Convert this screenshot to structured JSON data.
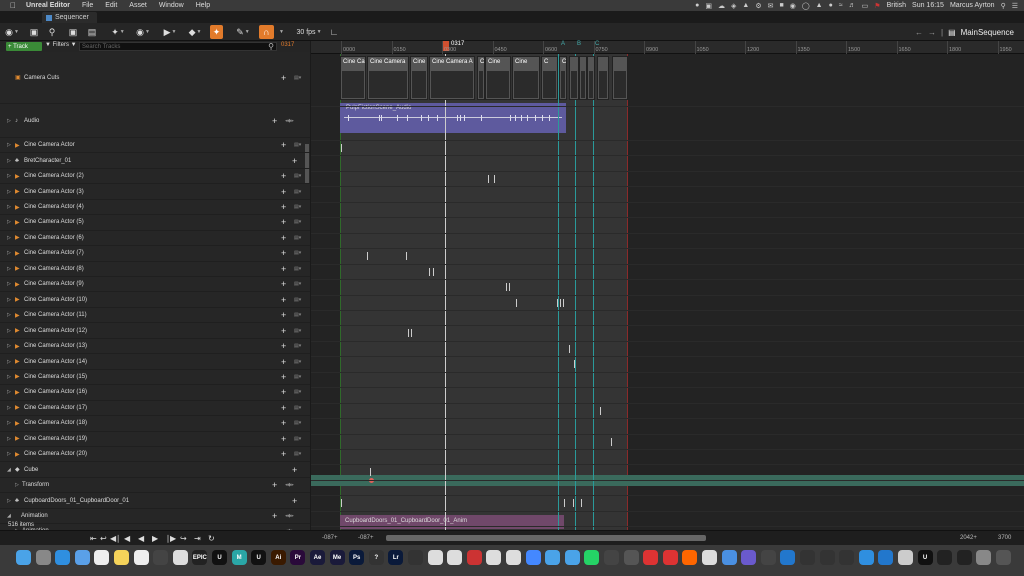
{
  "menubar": {
    "app": "Unreal Editor",
    "items": [
      "File",
      "Edit",
      "Asset",
      "Window",
      "Help"
    ],
    "language": "British",
    "clock": "Sun 16:15",
    "user": "Marcus Ayrton"
  },
  "tab": {
    "label": "Sequencer"
  },
  "toolbar": {
    "fps": "30 fps",
    "sequence": "MainSequence"
  },
  "tracks_header": {
    "track_label": "+ Track",
    "filters_label": "Filters",
    "search_placeholder": "Search Tracks",
    "current_frame": "0317"
  },
  "ruler": {
    "ticks": [
      "0000",
      "0150",
      "0300",
      "0450",
      "0600",
      "0750",
      "0900",
      "1050",
      "1200",
      "1350",
      "1500",
      "1650",
      "1800",
      "1950"
    ],
    "playhead": "0317",
    "markers": [
      "A",
      "B",
      "C"
    ]
  },
  "tracks": [
    {
      "label": "Camera Cuts",
      "kind": "cuts"
    },
    {
      "label": "Audio",
      "kind": "audio"
    },
    {
      "label": "Cine Camera Actor",
      "kind": "camera"
    },
    {
      "label": "BretCharacter_01",
      "kind": "character"
    },
    {
      "label": "Cine Camera Actor (2)",
      "kind": "camera"
    },
    {
      "label": "Cine Camera Actor (3)",
      "kind": "camera"
    },
    {
      "label": "Cine Camera Actor (4)",
      "kind": "camera"
    },
    {
      "label": "Cine Camera Actor (5)",
      "kind": "camera"
    },
    {
      "label": "Cine Camera Actor (6)",
      "kind": "camera"
    },
    {
      "label": "Cine Camera Actor (7)",
      "kind": "camera"
    },
    {
      "label": "Cine Camera Actor (8)",
      "kind": "camera"
    },
    {
      "label": "Cine Camera Actor (9)",
      "kind": "camera"
    },
    {
      "label": "Cine Camera Actor (10)",
      "kind": "camera"
    },
    {
      "label": "Cine Camera Actor (11)",
      "kind": "camera"
    },
    {
      "label": "Cine Camera Actor (12)",
      "kind": "camera"
    },
    {
      "label": "Cine Camera Actor (13)",
      "kind": "camera"
    },
    {
      "label": "Cine Camera Actor (14)",
      "kind": "camera"
    },
    {
      "label": "Cine Camera Actor (15)",
      "kind": "camera"
    },
    {
      "label": "Cine Camera Actor (16)",
      "kind": "camera"
    },
    {
      "label": "Cine Camera Actor (17)",
      "kind": "camera"
    },
    {
      "label": "Cine Camera Actor (18)",
      "kind": "camera"
    },
    {
      "label": "Cine Camera Actor (19)",
      "kind": "camera"
    },
    {
      "label": "Cine Camera Actor (20)",
      "kind": "camera"
    },
    {
      "label": "Cube",
      "kind": "cube"
    },
    {
      "label": "Transform",
      "kind": "transform"
    },
    {
      "label": "CupboardDoors_01_CupboardDoor_01",
      "kind": "character"
    },
    {
      "label": "Animation",
      "kind": "animation"
    },
    {
      "label": "Animation",
      "kind": "animation-sub"
    }
  ],
  "item_count": "516 items",
  "shots": [
    "Cine Ca",
    "Cine Camera",
    "Cine",
    "Cine Camera A",
    "C",
    "Cine",
    "Cine",
    "C",
    "Cine"
  ],
  "audio_clip": "PulpFictionScene_Audio",
  "anim_clip": "CupboardDoors_01_CupboardDoor_01_Anim",
  "bottom": {
    "range_start_a": "-087+",
    "range_start_b": "-087+",
    "range_end_a": "2042+",
    "range_end_b": "3700"
  },
  "dock": [
    {
      "name": "finder",
      "color": "#4aa3e8",
      "text": ""
    },
    {
      "name": "launchpad",
      "color": "#888",
      "text": ""
    },
    {
      "name": "safari",
      "color": "#2f8fe0",
      "text": ""
    },
    {
      "name": "mail",
      "color": "#5aa0e8",
      "text": ""
    },
    {
      "name": "calendar",
      "color": "#eeeeee",
      "text": ""
    },
    {
      "name": "notes",
      "color": "#f5d35a",
      "text": ""
    },
    {
      "name": "reminders",
      "color": "#eeeeee",
      "text": ""
    },
    {
      "name": "finalcut",
      "color": "#444",
      "text": ""
    },
    {
      "name": "photos",
      "color": "#dddddd",
      "text": ""
    },
    {
      "name": "epic",
      "color": "#222",
      "text": "EPIC"
    },
    {
      "name": "unreal",
      "color": "#111",
      "text": "U"
    },
    {
      "name": "maya",
      "color": "#2aa6a6",
      "text": "M"
    },
    {
      "name": "unreal2",
      "color": "#111",
      "text": "U"
    },
    {
      "name": "illustrator",
      "color": "#3a1a00",
      "text": "Ai"
    },
    {
      "name": "premiere",
      "color": "#2a0a3a",
      "text": "Pr"
    },
    {
      "name": "aftereffects",
      "color": "#1a1a3a",
      "text": "Ae"
    },
    {
      "name": "mediaencoder",
      "color": "#1a1a3a",
      "text": "Me"
    },
    {
      "name": "photoshop",
      "color": "#0a1a3a",
      "text": "Ps"
    },
    {
      "name": "help",
      "color": "#333",
      "text": "?"
    },
    {
      "name": "lightroom",
      "color": "#0a1a3a",
      "text": "Lr"
    },
    {
      "name": "blender",
      "color": "#333",
      "text": ""
    },
    {
      "name": "chrome",
      "color": "#dddddd",
      "text": ""
    },
    {
      "name": "app23",
      "color": "#dddddd",
      "text": ""
    },
    {
      "name": "app24",
      "color": "#cc3333",
      "text": ""
    },
    {
      "name": "app25",
      "color": "#dddddd",
      "text": ""
    },
    {
      "name": "app26",
      "color": "#dddddd",
      "text": ""
    },
    {
      "name": "app27",
      "color": "#4488ff",
      "text": ""
    },
    {
      "name": "app28",
      "color": "#4aa3e8",
      "text": ""
    },
    {
      "name": "app29",
      "color": "#4aa3e8",
      "text": ""
    },
    {
      "name": "whatsapp",
      "color": "#25d366",
      "text": ""
    },
    {
      "name": "app31",
      "color": "#444",
      "text": ""
    },
    {
      "name": "app32",
      "color": "#555",
      "text": ""
    },
    {
      "name": "app33",
      "color": "#dd3333",
      "text": ""
    },
    {
      "name": "app34",
      "color": "#dd3333",
      "text": ""
    },
    {
      "name": "app35",
      "color": "#ff6600",
      "text": ""
    },
    {
      "name": "app36",
      "color": "#dddddd",
      "text": ""
    },
    {
      "name": "app37",
      "color": "#4a90e2",
      "text": ""
    },
    {
      "name": "app38",
      "color": "#6a5acd",
      "text": ""
    },
    {
      "name": "app39",
      "color": "#444",
      "text": ""
    },
    {
      "name": "app40",
      "color": "#2277cc",
      "text": ""
    },
    {
      "name": "app41",
      "color": "#333",
      "text": ""
    },
    {
      "name": "app42",
      "color": "#333",
      "text": ""
    },
    {
      "name": "app43",
      "color": "#333",
      "text": ""
    },
    {
      "name": "app44",
      "color": "#2f8fe0",
      "text": ""
    },
    {
      "name": "app45",
      "color": "#2277cc",
      "text": ""
    },
    {
      "name": "app46",
      "color": "#cccccc",
      "text": ""
    },
    {
      "name": "unreal3",
      "color": "#111",
      "text": "U"
    },
    {
      "name": "app48",
      "color": "#222",
      "text": ""
    },
    {
      "name": "app49",
      "color": "#222",
      "text": ""
    },
    {
      "name": "app50",
      "color": "#888",
      "text": ""
    },
    {
      "name": "trash",
      "color": "#555",
      "text": ""
    }
  ],
  "colors": {
    "accent_orange": "#e27b2b",
    "audio_clip": "#5e5a9e",
    "anim_clip": "#70486a",
    "transform_row": "#3a6a5c",
    "track_button": "#3a8a37"
  }
}
